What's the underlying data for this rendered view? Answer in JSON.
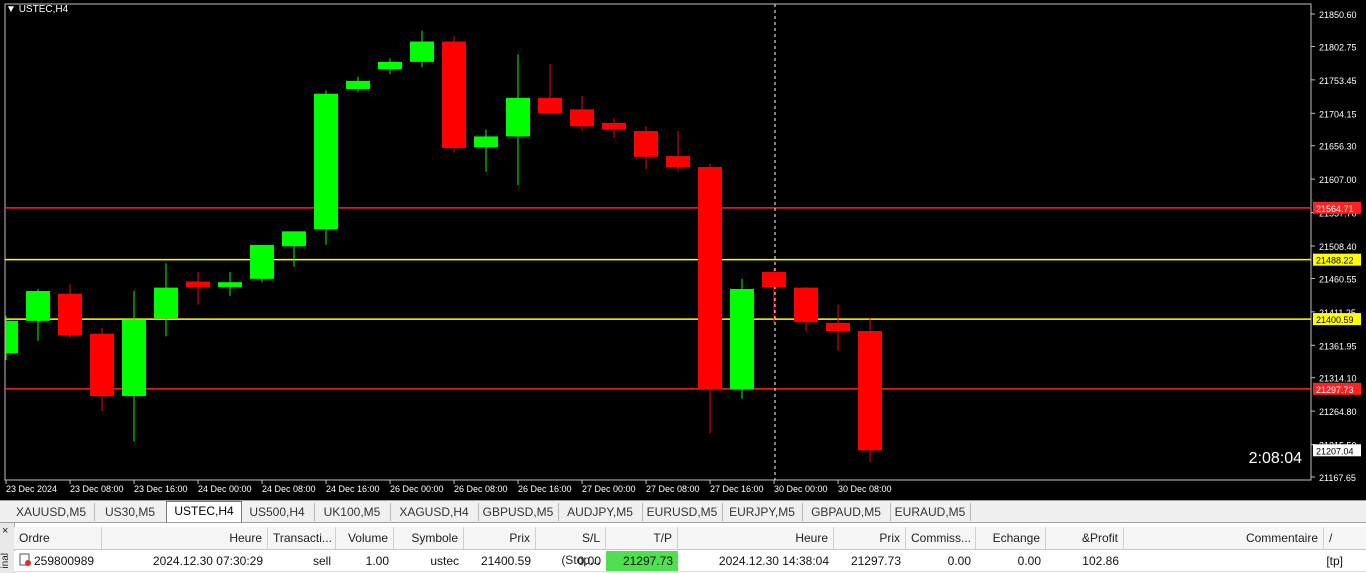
{
  "chart": {
    "symbol_label": "USTEC,H4",
    "timer": "2:08:04",
    "colors": {
      "bull": "#00ff00",
      "bear": "#ff0000",
      "support": "#ffff00",
      "level_red": "#ff2020",
      "background": "#000000"
    },
    "price_ticks": [
      "21850.60",
      "21802.75",
      "21753.45",
      "21704.15",
      "21656.30",
      "21607.00",
      "21557.70",
      "21508.40",
      "21460.55",
      "21411.25",
      "21361.95",
      "21314.10",
      "21264.80",
      "21215.50",
      "21167.65"
    ],
    "time_ticks": [
      "23 Dec 2024",
      "23 Dec 08:00",
      "23 Dec 16:00",
      "24 Dec 00:00",
      "24 Dec 08:00",
      "24 Dec 16:00",
      "26 Dec 00:00",
      "26 Dec 08:00",
      "26 Dec 16:00",
      "27 Dec 00:00",
      "27 Dec 08:00",
      "27 Dec 16:00",
      "30 Dec 00:00",
      "30 Dec 08:00"
    ],
    "levels": [
      {
        "price": 21564.71,
        "label": "21564.71",
        "color": "#ff2020"
      },
      {
        "price": 21488.22,
        "label": "21488.22",
        "color": "#ffff00"
      },
      {
        "price": 21400.59,
        "label": "21400.59",
        "color": "#ffff00"
      },
      {
        "price": 21297.73,
        "label": "21297.73",
        "color": "#ff2020"
      }
    ],
    "current_price_label": "21207.04",
    "candles": [
      {
        "o": 21350,
        "h": 21405,
        "l": 21340,
        "c": 21398
      },
      {
        "o": 21398,
        "h": 21445,
        "l": 21368,
        "c": 21442
      },
      {
        "o": 21438,
        "h": 21452,
        "l": 21372,
        "c": 21377
      },
      {
        "o": 21379,
        "h": 21388,
        "l": 21265,
        "c": 21287
      },
      {
        "o": 21287,
        "h": 21442,
        "l": 21220,
        "c": 21400
      },
      {
        "o": 21402,
        "h": 21483,
        "l": 21375,
        "c": 21447
      },
      {
        "o": 21456,
        "h": 21470,
        "l": 21422,
        "c": 21448
      },
      {
        "o": 21448,
        "h": 21470,
        "l": 21435,
        "c": 21455
      },
      {
        "o": 21460,
        "h": 21506,
        "l": 21455,
        "c": 21510
      },
      {
        "o": 21508,
        "h": 21525,
        "l": 21478,
        "c": 21530
      },
      {
        "o": 21533,
        "h": 21738,
        "l": 21510,
        "c": 21733
      },
      {
        "o": 21740,
        "h": 21758,
        "l": 21735,
        "c": 21752
      },
      {
        "o": 21769,
        "h": 21785,
        "l": 21762,
        "c": 21780
      },
      {
        "o": 21780,
        "h": 21826,
        "l": 21772,
        "c": 21810
      },
      {
        "o": 21810,
        "h": 21818,
        "l": 21646,
        "c": 21653
      },
      {
        "o": 21654,
        "h": 21680,
        "l": 21618,
        "c": 21670
      },
      {
        "o": 21670,
        "h": 21791,
        "l": 21598,
        "c": 21727
      },
      {
        "o": 21727,
        "h": 21777,
        "l": 21710,
        "c": 21704
      },
      {
        "o": 21710,
        "h": 21730,
        "l": 21678,
        "c": 21685
      },
      {
        "o": 21690,
        "h": 21697,
        "l": 21668,
        "c": 21680
      },
      {
        "o": 21678,
        "h": 21685,
        "l": 21622,
        "c": 21640
      },
      {
        "o": 21641,
        "h": 21678,
        "l": 21618,
        "c": 21625
      },
      {
        "o": 21625,
        "h": 21630,
        "l": 21232,
        "c": 21297
      },
      {
        "o": 21297,
        "h": 21460,
        "l": 21283,
        "c": 21445
      },
      {
        "o": 21470,
        "h": 21475,
        "l": 21395,
        "c": 21448
      },
      {
        "o": 21447,
        "h": 21448,
        "l": 21383,
        "c": 21396
      },
      {
        "o": 21395,
        "h": 21422,
        "l": 21354,
        "c": 21383
      },
      {
        "o": 21383,
        "h": 21402,
        "l": 21190,
        "c": 21207
      }
    ]
  },
  "tabs": [
    "XAUUSD,M5",
    "US30,M5",
    "USTEC,H4",
    "US500,H4",
    "UK100,M5",
    "XAGUSD,H4",
    "GBPUSD,M5",
    "AUDJPY,M5",
    "EURUSD,M5",
    "EURJPY,M5",
    "GBPAUD,M5",
    "EURAUD,M5"
  ],
  "active_tab": "USTEC,H4",
  "terminal": {
    "side_label": "inal",
    "close": "×",
    "headers": {
      "ordre": "Ordre",
      "heure": "Heure",
      "transaction": "Transacti...",
      "volume": "Volume",
      "symbole": "Symbole",
      "prix": "Prix",
      "sl": "S/L (Stop...",
      "tp": "T/P (Pren...",
      "heure2": "Heure",
      "prix2": "Prix",
      "commission": "Commiss...",
      "echange": "Echange",
      "profit": "&Profit",
      "commentaire": "Commentaire",
      "sort": "/"
    },
    "row": {
      "ordre": "259800989",
      "heure": "2024.12.30 07:30:29",
      "transaction": "sell",
      "volume": "1.00",
      "symbole": "ustec",
      "prix": "21400.59",
      "sl": "0.00",
      "tp": "21297.73",
      "heure2": "2024.12.30 14:38:04",
      "prix2": "21297.73",
      "commission": "0.00",
      "echange": "0.00",
      "profit": "102.86",
      "commentaire": "[tp]"
    }
  }
}
